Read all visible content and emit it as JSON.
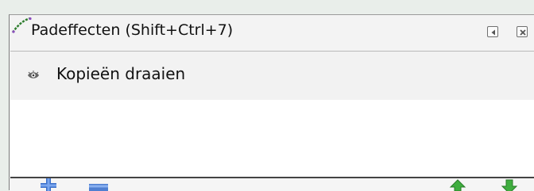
{
  "panel": {
    "title": "Padeffecten (Shift+Ctrl+7)",
    "title_icon": "path-effects-icon",
    "buttons": {
      "iconify_icon": "iconify-icon",
      "close_icon": "close-icon"
    }
  },
  "effects_list": {
    "items": [
      {
        "label": "Kopieën draaien",
        "visibility_icon": "eye-icon"
      }
    ]
  },
  "toolbar": {
    "add_icon": "add-icon",
    "remove_icon": "remove-icon",
    "move_up_icon": "arrow-up-icon",
    "move_down_icon": "arrow-down-icon"
  },
  "colors": {
    "add": "#3b6fc9",
    "remove": "#4f7fd1",
    "move": "#3fae3f"
  }
}
